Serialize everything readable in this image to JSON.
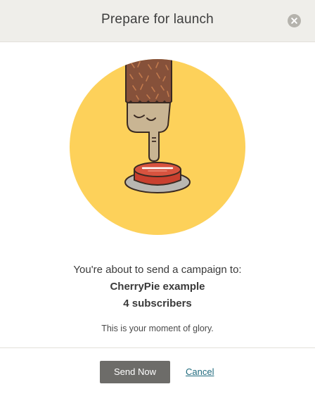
{
  "header": {
    "title": "Prepare for launch",
    "close_icon": "close-icon"
  },
  "illustration": {
    "icon": "finger-press-button-icon",
    "circle_color": "#fdd15a",
    "button_color": "#c9402f"
  },
  "body": {
    "intro": "You're about to send a campaign to:",
    "list_name": "CherryPie example",
    "subscribers": "4 subscribers",
    "glory": "This is your moment of glory."
  },
  "footer": {
    "send_label": "Send Now",
    "cancel_label": "Cancel"
  }
}
